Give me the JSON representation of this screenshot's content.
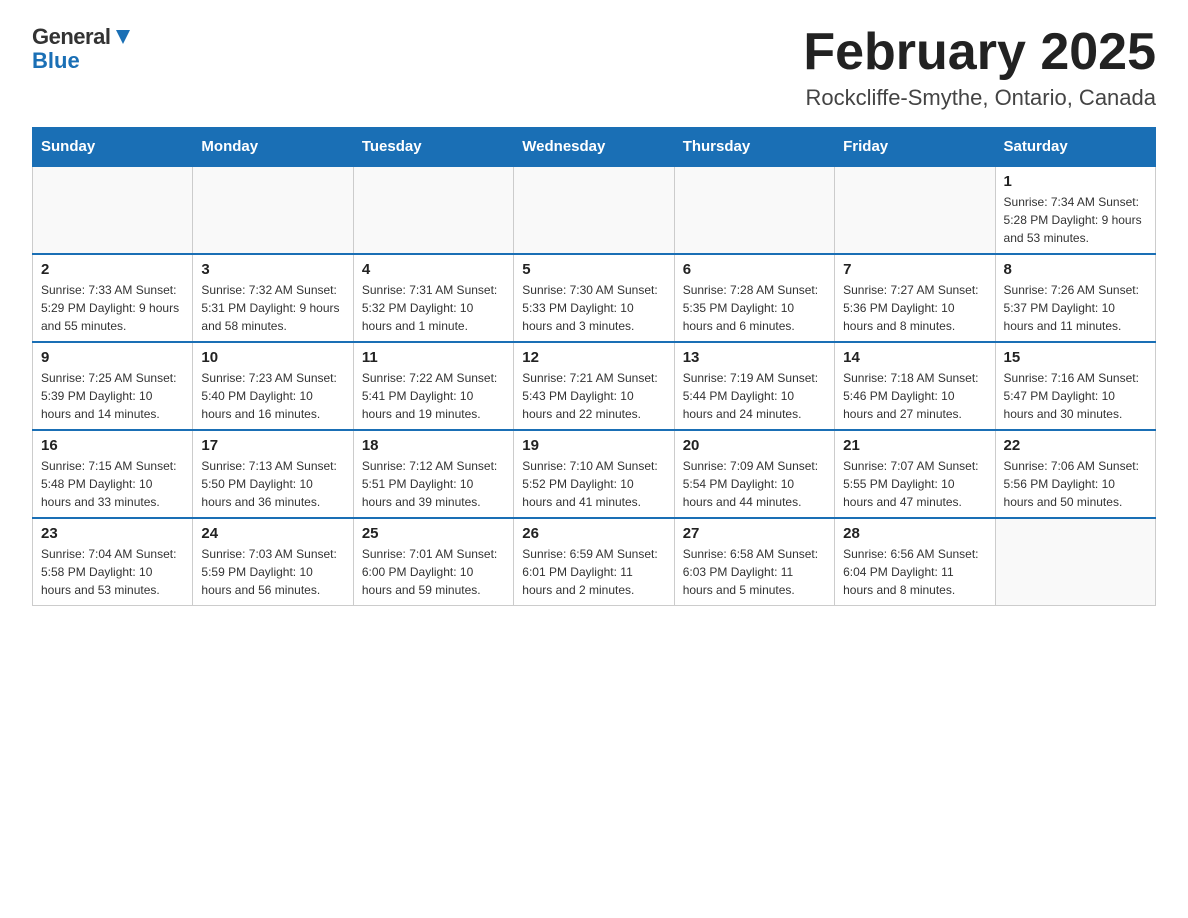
{
  "header": {
    "logo_general": "General",
    "logo_blue": "Blue",
    "month_title": "February 2025",
    "location": "Rockcliffe-Smythe, Ontario, Canada"
  },
  "weekdays": [
    "Sunday",
    "Monday",
    "Tuesday",
    "Wednesday",
    "Thursday",
    "Friday",
    "Saturday"
  ],
  "weeks": [
    [
      {
        "day": "",
        "info": ""
      },
      {
        "day": "",
        "info": ""
      },
      {
        "day": "",
        "info": ""
      },
      {
        "day": "",
        "info": ""
      },
      {
        "day": "",
        "info": ""
      },
      {
        "day": "",
        "info": ""
      },
      {
        "day": "1",
        "info": "Sunrise: 7:34 AM\nSunset: 5:28 PM\nDaylight: 9 hours and 53 minutes."
      }
    ],
    [
      {
        "day": "2",
        "info": "Sunrise: 7:33 AM\nSunset: 5:29 PM\nDaylight: 9 hours and 55 minutes."
      },
      {
        "day": "3",
        "info": "Sunrise: 7:32 AM\nSunset: 5:31 PM\nDaylight: 9 hours and 58 minutes."
      },
      {
        "day": "4",
        "info": "Sunrise: 7:31 AM\nSunset: 5:32 PM\nDaylight: 10 hours and 1 minute."
      },
      {
        "day": "5",
        "info": "Sunrise: 7:30 AM\nSunset: 5:33 PM\nDaylight: 10 hours and 3 minutes."
      },
      {
        "day": "6",
        "info": "Sunrise: 7:28 AM\nSunset: 5:35 PM\nDaylight: 10 hours and 6 minutes."
      },
      {
        "day": "7",
        "info": "Sunrise: 7:27 AM\nSunset: 5:36 PM\nDaylight: 10 hours and 8 minutes."
      },
      {
        "day": "8",
        "info": "Sunrise: 7:26 AM\nSunset: 5:37 PM\nDaylight: 10 hours and 11 minutes."
      }
    ],
    [
      {
        "day": "9",
        "info": "Sunrise: 7:25 AM\nSunset: 5:39 PM\nDaylight: 10 hours and 14 minutes."
      },
      {
        "day": "10",
        "info": "Sunrise: 7:23 AM\nSunset: 5:40 PM\nDaylight: 10 hours and 16 minutes."
      },
      {
        "day": "11",
        "info": "Sunrise: 7:22 AM\nSunset: 5:41 PM\nDaylight: 10 hours and 19 minutes."
      },
      {
        "day": "12",
        "info": "Sunrise: 7:21 AM\nSunset: 5:43 PM\nDaylight: 10 hours and 22 minutes."
      },
      {
        "day": "13",
        "info": "Sunrise: 7:19 AM\nSunset: 5:44 PM\nDaylight: 10 hours and 24 minutes."
      },
      {
        "day": "14",
        "info": "Sunrise: 7:18 AM\nSunset: 5:46 PM\nDaylight: 10 hours and 27 minutes."
      },
      {
        "day": "15",
        "info": "Sunrise: 7:16 AM\nSunset: 5:47 PM\nDaylight: 10 hours and 30 minutes."
      }
    ],
    [
      {
        "day": "16",
        "info": "Sunrise: 7:15 AM\nSunset: 5:48 PM\nDaylight: 10 hours and 33 minutes."
      },
      {
        "day": "17",
        "info": "Sunrise: 7:13 AM\nSunset: 5:50 PM\nDaylight: 10 hours and 36 minutes."
      },
      {
        "day": "18",
        "info": "Sunrise: 7:12 AM\nSunset: 5:51 PM\nDaylight: 10 hours and 39 minutes."
      },
      {
        "day": "19",
        "info": "Sunrise: 7:10 AM\nSunset: 5:52 PM\nDaylight: 10 hours and 41 minutes."
      },
      {
        "day": "20",
        "info": "Sunrise: 7:09 AM\nSunset: 5:54 PM\nDaylight: 10 hours and 44 minutes."
      },
      {
        "day": "21",
        "info": "Sunrise: 7:07 AM\nSunset: 5:55 PM\nDaylight: 10 hours and 47 minutes."
      },
      {
        "day": "22",
        "info": "Sunrise: 7:06 AM\nSunset: 5:56 PM\nDaylight: 10 hours and 50 minutes."
      }
    ],
    [
      {
        "day": "23",
        "info": "Sunrise: 7:04 AM\nSunset: 5:58 PM\nDaylight: 10 hours and 53 minutes."
      },
      {
        "day": "24",
        "info": "Sunrise: 7:03 AM\nSunset: 5:59 PM\nDaylight: 10 hours and 56 minutes."
      },
      {
        "day": "25",
        "info": "Sunrise: 7:01 AM\nSunset: 6:00 PM\nDaylight: 10 hours and 59 minutes."
      },
      {
        "day": "26",
        "info": "Sunrise: 6:59 AM\nSunset: 6:01 PM\nDaylight: 11 hours and 2 minutes."
      },
      {
        "day": "27",
        "info": "Sunrise: 6:58 AM\nSunset: 6:03 PM\nDaylight: 11 hours and 5 minutes."
      },
      {
        "day": "28",
        "info": "Sunrise: 6:56 AM\nSunset: 6:04 PM\nDaylight: 11 hours and 8 minutes."
      },
      {
        "day": "",
        "info": ""
      }
    ]
  ]
}
